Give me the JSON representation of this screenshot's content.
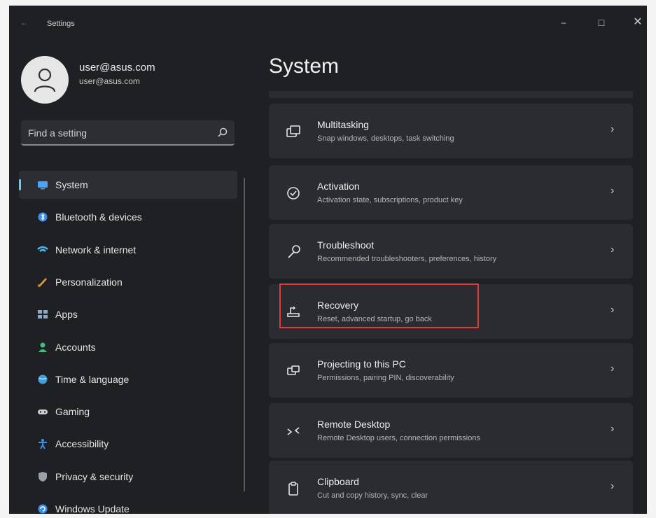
{
  "window": {
    "title": "Settings",
    "back": "←",
    "controls": {
      "minimize": "–",
      "maximize": "□",
      "close": "✕"
    }
  },
  "user": {
    "name": "user@asus.com",
    "email": "user@asus.com"
  },
  "search": {
    "placeholder": "Find a setting"
  },
  "nav": {
    "items": [
      {
        "label": "System",
        "icon": "system-icon",
        "color": "#4aa3ff",
        "selected": true
      },
      {
        "label": "Bluetooth & devices",
        "icon": "bluetooth-icon",
        "color": "#3b8eea"
      },
      {
        "label": "Network & internet",
        "icon": "network-icon",
        "color": "#4fb8e8"
      },
      {
        "label": "Personalization",
        "icon": "brush-icon",
        "color": "#e0a040"
      },
      {
        "label": "Apps",
        "icon": "apps-icon",
        "color": "#8fa8c8"
      },
      {
        "label": "Accounts",
        "icon": "accounts-icon",
        "color": "#3fbf7f"
      },
      {
        "label": "Time & language",
        "icon": "globe-icon",
        "color": "#3fa0e0"
      },
      {
        "label": "Gaming",
        "icon": "gamepad-icon",
        "color": "#cfcfcf"
      },
      {
        "label": "Accessibility",
        "icon": "accessibility-icon",
        "color": "#3b8eea"
      },
      {
        "label": "Privacy & security",
        "icon": "shield-icon",
        "color": "#9aa0a8"
      },
      {
        "label": "Windows Update",
        "icon": "update-icon",
        "color": "#3b8eea"
      }
    ]
  },
  "main": {
    "title": "System",
    "cards": [
      {
        "title": "Multitasking",
        "subtitle": "Snap windows, desktops, task switching",
        "icon": "multitasking-icon"
      },
      {
        "title": "Activation",
        "subtitle": "Activation state, subscriptions, product key",
        "icon": "activation-icon"
      },
      {
        "title": "Troubleshoot",
        "subtitle": "Recommended troubleshooters, preferences, history",
        "icon": "troubleshoot-icon"
      },
      {
        "title": "Recovery",
        "subtitle": "Reset, advanced startup, go back",
        "icon": "recovery-icon",
        "highlighted": true
      },
      {
        "title": "Projecting to this PC",
        "subtitle": "Permissions, pairing PIN, discoverability",
        "icon": "projecting-icon"
      },
      {
        "title": "Remote Desktop",
        "subtitle": "Remote Desktop users, connection permissions",
        "icon": "remote-desktop-icon"
      },
      {
        "title": "Clipboard",
        "subtitle": "Cut and copy history, sync, clear",
        "icon": "clipboard-icon"
      }
    ]
  },
  "colors": {
    "window_bg": "#1f2024",
    "card_bg": "#2b2c31",
    "accent": "#60cdff",
    "highlight": "#e23a3a"
  }
}
